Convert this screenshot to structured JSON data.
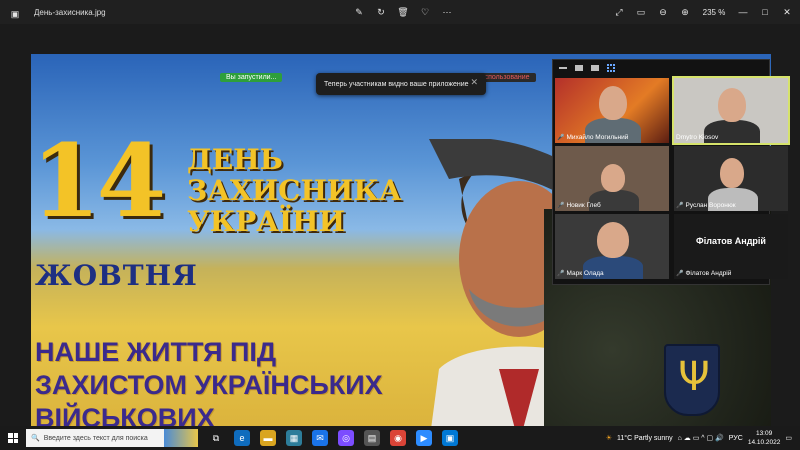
{
  "window": {
    "title": "День-захисника.jpg",
    "zoom": "235 %"
  },
  "poster": {
    "number": "14",
    "title_lines": [
      "ДЕНЬ",
      "ЗАХИСНИКА",
      "УКРАЇНИ"
    ],
    "month": "ЖОВТНЯ",
    "motto_lines": [
      "НАШЕ ЖИТТЯ ПІД",
      "ЗАХИСТОМ УКРАЇНСЬКИХ",
      "ВІЙСЬКОВИХ"
    ]
  },
  "share": {
    "green_notice": "Вы запустили...",
    "red_notice": "Остановить совместное использование",
    "toast": "Теперь участникам видно ваше приложение"
  },
  "participants": [
    {
      "name": "Михайло Могильний",
      "muted": true
    },
    {
      "name": "Dmytro Kiosov",
      "muted": false,
      "active": true
    },
    {
      "name": "Новик Глеб",
      "muted": true
    },
    {
      "name": "Руслан Воронюк",
      "muted": true
    },
    {
      "name": "Марк Олада",
      "muted": true
    },
    {
      "name": "Філатов Андрій",
      "muted": true,
      "display_text": "Філатов Андрій"
    }
  ],
  "taskbar": {
    "search_placeholder": "Введите здесь текст для поиска",
    "weather": "11°C  Partly sunny",
    "language": "РУС",
    "time": "13:09",
    "date": "14.10.2022"
  },
  "colors": {
    "poster_gold": "#f3c327",
    "poster_blue": "#1e2f82",
    "active_speaker": "#d6e36b",
    "share_green": "#2e9f3b"
  }
}
